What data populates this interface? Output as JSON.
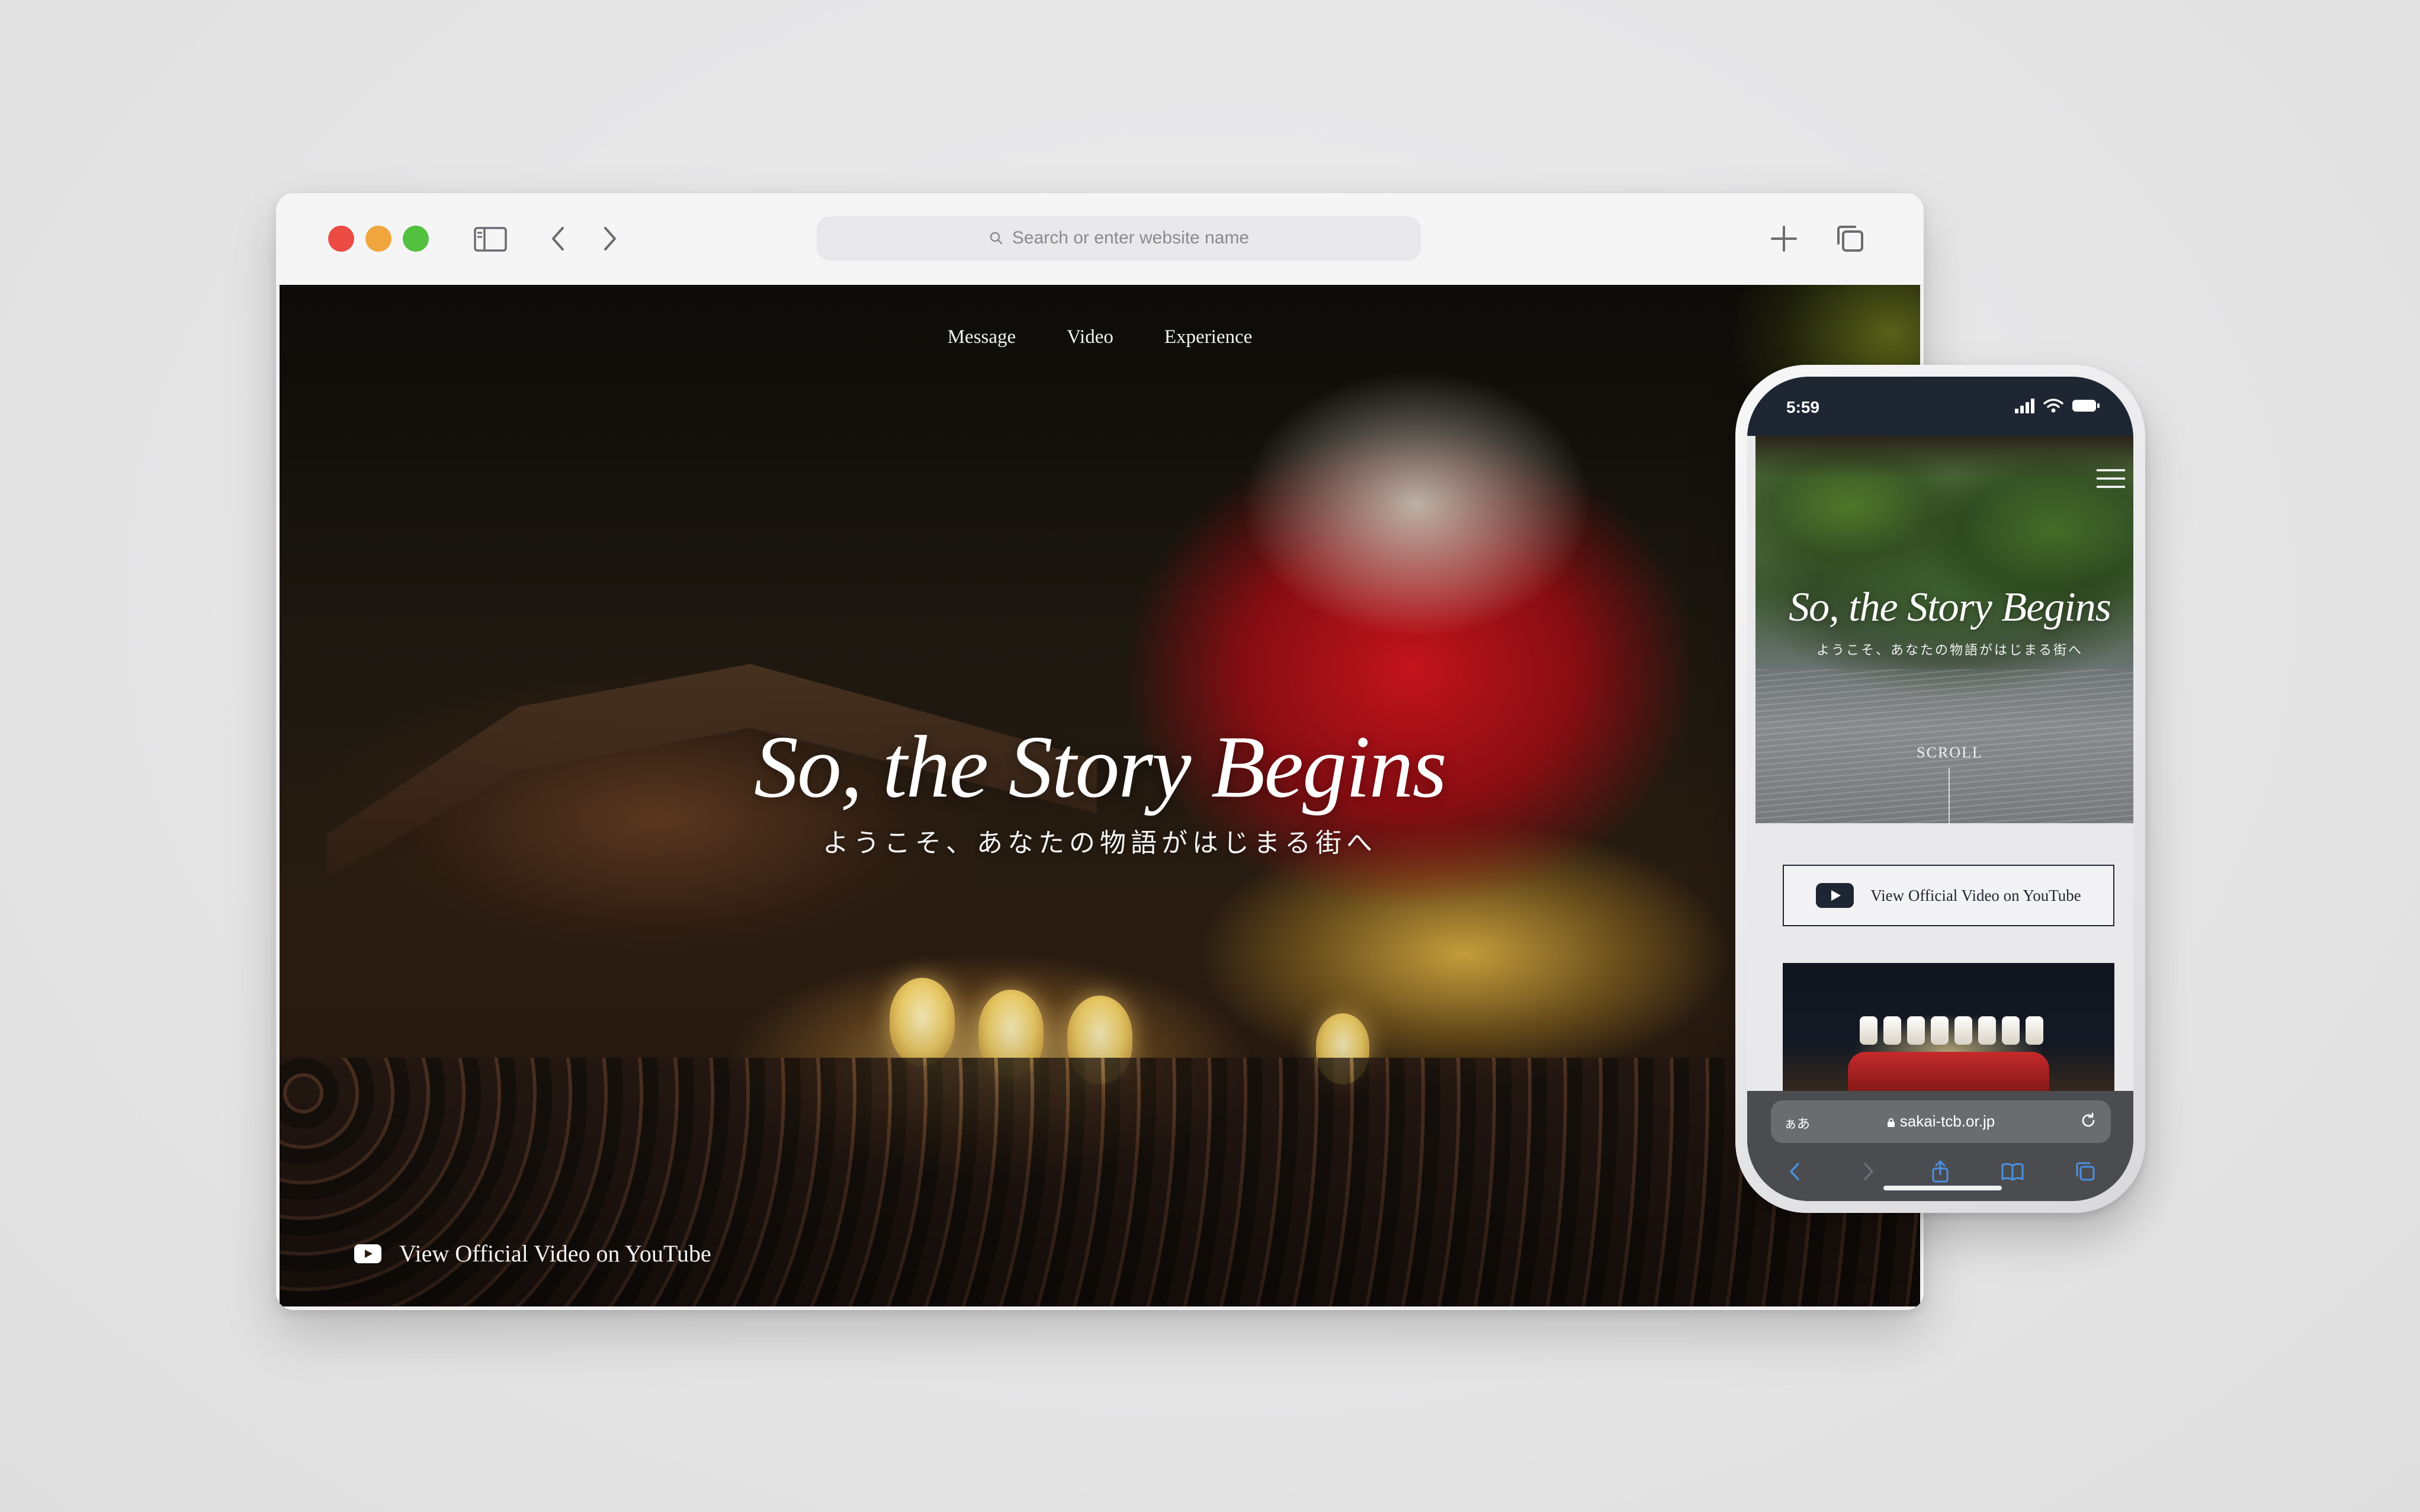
{
  "desktop": {
    "address_placeholder": "Search or enter website name",
    "nav": [
      "Message",
      "Video",
      "Experience"
    ],
    "hero_title": "So, the Story Begins",
    "hero_subtitle": "ようこそ、あなたの物語がはじまる街へ",
    "youtube_link": "View Official Video on YouTube"
  },
  "mobile": {
    "time": "5:59",
    "hero_title": "So, the Story Begins",
    "hero_subtitle": "ようこそ、あなたの物語がはじまる街へ",
    "scroll_label": "SCROLL",
    "youtube_button": "View Official Video on YouTube",
    "url_aa": "ぁあ",
    "url": "sakai-tcb.or.jp"
  },
  "colors": {
    "red_button": "#ec4b43",
    "yellow_button": "#f0a63c",
    "green_button": "#52c13f",
    "navy": "#1f2633"
  },
  "icons": [
    "sidebar-icon",
    "back-icon",
    "forward-icon",
    "new-tab-icon",
    "tabs-icon",
    "search-icon",
    "youtube-icon",
    "menu-icon",
    "lock-icon",
    "reload-icon",
    "share-icon",
    "bookmarks-icon"
  ]
}
